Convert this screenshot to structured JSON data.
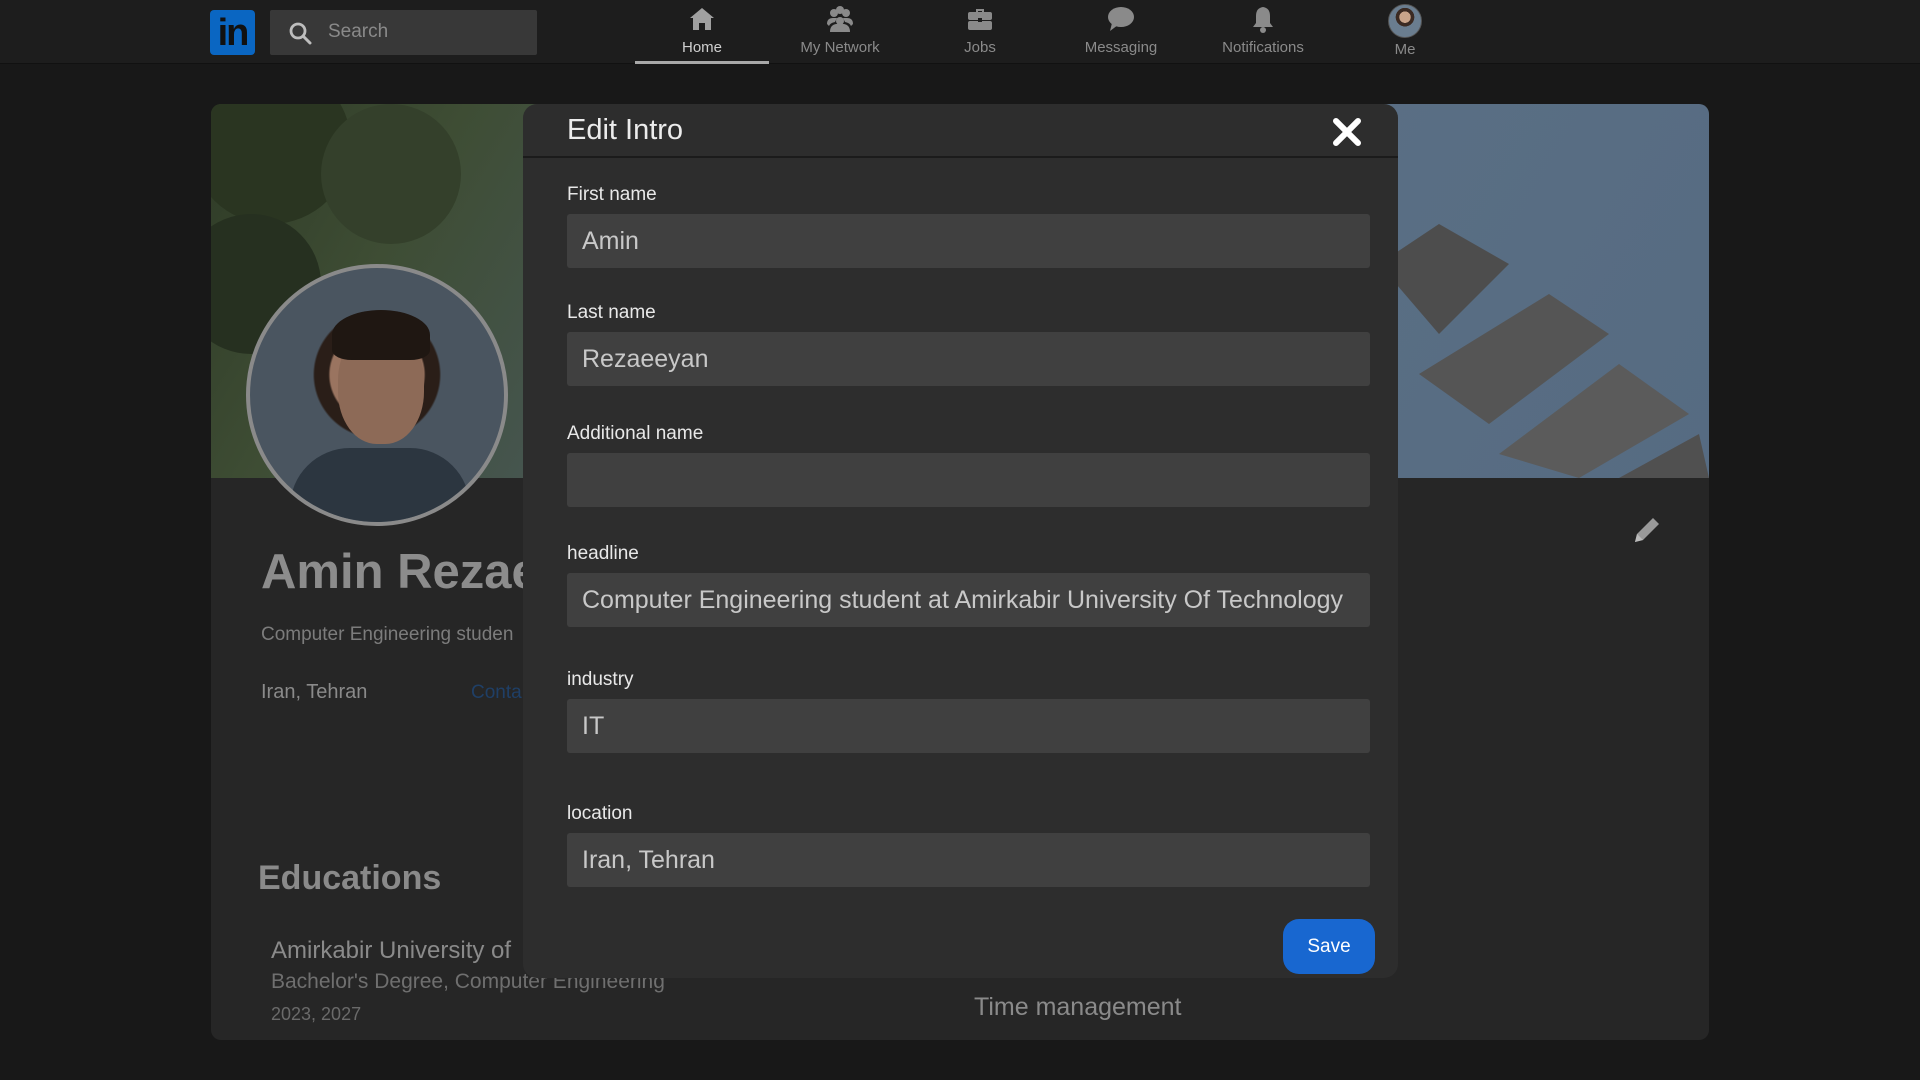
{
  "nav": {
    "logo_text": "in",
    "search_placeholder": "Search",
    "items": [
      {
        "label": "Home",
        "icon": "home-icon",
        "active": true
      },
      {
        "label": "My Network",
        "icon": "network-icon"
      },
      {
        "label": "Jobs",
        "icon": "briefcase-icon"
      },
      {
        "label": "Messaging",
        "icon": "chat-icon"
      },
      {
        "label": "Notifications",
        "icon": "bell-icon"
      },
      {
        "label": "Me",
        "icon": "avatar"
      }
    ]
  },
  "profile": {
    "name": "Amin Rezae",
    "headline": "Computer Engineering studen",
    "location": "Iran, Tehran",
    "contact": "Conta",
    "educations_title": "Educations",
    "education": {
      "school": "Amirkabir University of",
      "degree": "Bachelor's Degree, Computer Engineering",
      "years": "2023, 2027"
    },
    "skill": "Time management"
  },
  "modal": {
    "title": "Edit Intro",
    "fields": {
      "first_name": {
        "label": "First name",
        "value": "Amin"
      },
      "last_name": {
        "label": "Last name",
        "value": "Rezaeeyan"
      },
      "additional_name": {
        "label": "Additional name",
        "value": ""
      },
      "headline": {
        "label": "headline",
        "value": "Computer Engineering student at Amirkabir University Of Technology"
      },
      "industry": {
        "label": "industry",
        "value": "IT"
      },
      "location": {
        "label": "location",
        "value": "Iran, Tehran"
      }
    },
    "save_label": "Save"
  },
  "colors": {
    "accent": "#1867d0",
    "logo_bg": "#0a66c2",
    "modal_bg": "#2d2d2d",
    "input_bg": "#404040"
  }
}
